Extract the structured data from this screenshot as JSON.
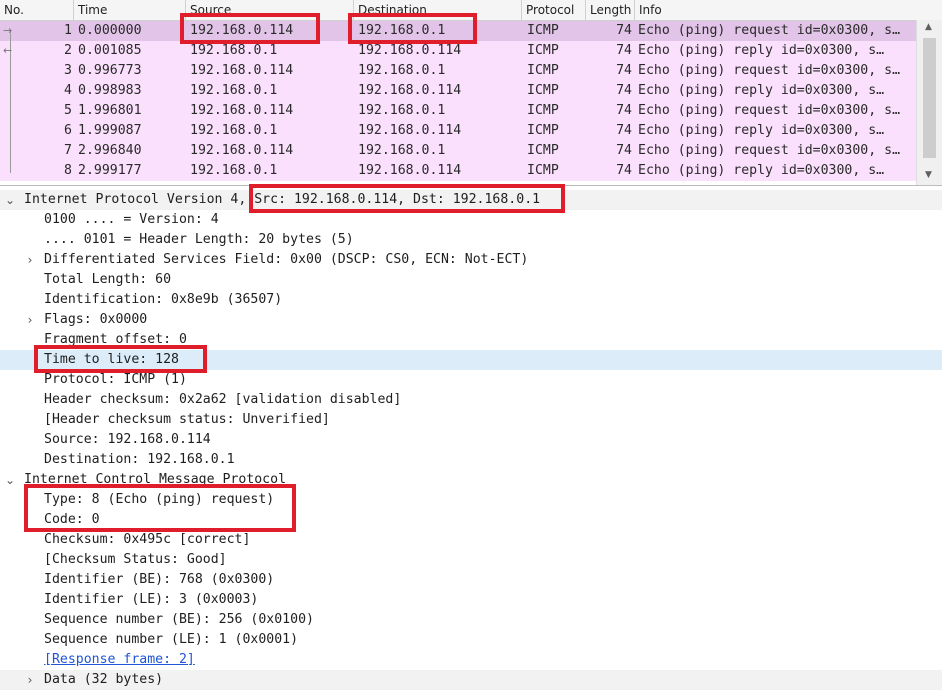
{
  "columns": {
    "no": "No.",
    "time": "Time",
    "source": "Source",
    "destination": "Destination",
    "protocol": "Protocol",
    "length": "Length",
    "info": "Info"
  },
  "packets": [
    {
      "no": "1",
      "time": "0.000000",
      "src": "192.168.0.114",
      "dst": "192.168.0.1",
      "proto": "ICMP",
      "len": "74",
      "info": "Echo (ping) request  id=0x0300, s…"
    },
    {
      "no": "2",
      "time": "0.001085",
      "src": "192.168.0.1",
      "dst": "192.168.0.114",
      "proto": "ICMP",
      "len": "74",
      "info": "Echo (ping) reply    id=0x0300, s…"
    },
    {
      "no": "3",
      "time": "0.996773",
      "src": "192.168.0.114",
      "dst": "192.168.0.1",
      "proto": "ICMP",
      "len": "74",
      "info": "Echo (ping) request  id=0x0300, s…"
    },
    {
      "no": "4",
      "time": "0.998983",
      "src": "192.168.0.1",
      "dst": "192.168.0.114",
      "proto": "ICMP",
      "len": "74",
      "info": "Echo (ping) reply    id=0x0300, s…"
    },
    {
      "no": "5",
      "time": "1.996801",
      "src": "192.168.0.114",
      "dst": "192.168.0.1",
      "proto": "ICMP",
      "len": "74",
      "info": "Echo (ping) request  id=0x0300, s…"
    },
    {
      "no": "6",
      "time": "1.999087",
      "src": "192.168.0.1",
      "dst": "192.168.0.114",
      "proto": "ICMP",
      "len": "74",
      "info": "Echo (ping) reply    id=0x0300, s…"
    },
    {
      "no": "7",
      "time": "2.996840",
      "src": "192.168.0.114",
      "dst": "192.168.0.1",
      "proto": "ICMP",
      "len": "74",
      "info": "Echo (ping) request  id=0x0300, s…"
    },
    {
      "no": "8",
      "time": "2.999177",
      "src": "192.168.0.1",
      "dst": "192.168.0.114",
      "proto": "ICMP",
      "len": "74",
      "info": "Echo (ping) reply    id=0x0300, s…"
    }
  ],
  "details": {
    "ip_header": "Internet Protocol Version 4, Src: 192.168.0.114, Dst: 192.168.0.1",
    "version": "0100 .... = Version: 4",
    "header_length": ".... 0101 = Header Length: 20 bytes (5)",
    "dsf": "Differentiated Services Field: 0x00 (DSCP: CS0, ECN: Not-ECT)",
    "total_length": "Total Length: 60",
    "identification": "Identification: 0x8e9b (36507)",
    "flags": "Flags: 0x0000",
    "fragment_offset": "Fragment offset: 0",
    "ttl": "Time to live: 128",
    "protocol": "Protocol: ICMP (1)",
    "header_checksum": "Header checksum: 0x2a62 [validation disabled]",
    "header_checksum_status": "[Header checksum status: Unverified]",
    "source": "Source: 192.168.0.114",
    "destination": "Destination: 192.168.0.1",
    "icmp_header": "Internet Control Message Protocol",
    "type": "Type: 8 (Echo (ping) request)",
    "code": "Code: 0",
    "checksum": "Checksum: 0x495c [correct]",
    "checksum_status": "[Checksum Status: Good]",
    "identifier_be": "Identifier (BE): 768 (0x0300)",
    "identifier_le": "Identifier (LE): 3 (0x0003)",
    "seq_be": "Sequence number (BE): 256 (0x0100)",
    "seq_le": "Sequence number (LE): 1 (0x0001)",
    "response_frame": "[Response frame: 2]",
    "data": "Data (32 bytes)"
  },
  "icons": {
    "expanded": "chevron-down-icon",
    "collapsed": "chevron-right-icon",
    "request_arrow": "arrow-right-icon",
    "reply_arrow": "arrow-left-icon"
  },
  "colors": {
    "icmp_row": "#fbe0fd",
    "icmp_row_selected": "#e2c4e8",
    "selected_field": "#dcecf9",
    "annotation_box": "#e01d2a",
    "link": "#1f55d6"
  }
}
